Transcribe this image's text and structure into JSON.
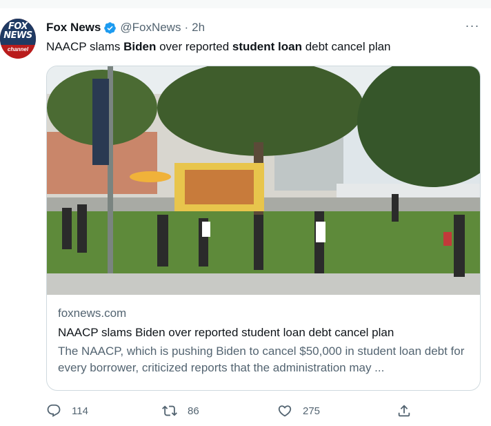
{
  "tweet": {
    "author_name": "Fox News",
    "handle": "@FoxNews",
    "separator": "·",
    "time": "2h",
    "more_label": "···",
    "avatar_logo": "FOX NEWS channel",
    "text_parts": [
      {
        "t": "NAACP slams ",
        "bold": false
      },
      {
        "t": "Biden",
        "bold": true
      },
      {
        "t": " over reported ",
        "bold": false
      },
      {
        "t": "student loan",
        "bold": true
      },
      {
        "t": " debt cancel plan",
        "bold": false
      }
    ]
  },
  "card": {
    "domain": "foxnews.com",
    "title": "NAACP slams Biden over reported student loan debt cancel plan",
    "description": "The NAACP, which is pushing Biden to cancel $50,000 in student loan debt for every borrower, criticized reports that the administration may ..."
  },
  "actions": {
    "replies": "114",
    "retweets": "86",
    "likes": "275"
  },
  "colors": {
    "verified": "#1d9bf0",
    "secondary_text": "#536471",
    "border": "#cfd9de"
  },
  "icons": [
    "verified-badge-icon",
    "more-icon",
    "reply-icon",
    "retweet-icon",
    "like-icon",
    "share-icon"
  ]
}
